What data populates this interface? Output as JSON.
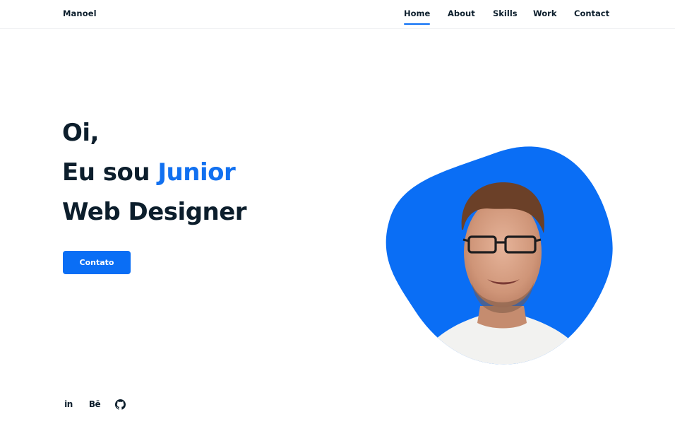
{
  "header": {
    "brand": "Manoel",
    "nav": [
      {
        "label": "Home",
        "active": true
      },
      {
        "label": "About",
        "active": false
      },
      {
        "label": "Skills",
        "active": false
      },
      {
        "label": "Work",
        "active": false
      },
      {
        "label": "Contact",
        "active": false
      }
    ]
  },
  "hero": {
    "greeting": "Oi,",
    "intro_prefix": "Eu sou ",
    "name": "Junior",
    "role": "Web Designer",
    "cta_label": "Contato"
  },
  "social": [
    {
      "icon": "linkedin-icon",
      "text": "in"
    },
    {
      "icon": "behance-icon",
      "text": "Bē"
    },
    {
      "icon": "github-icon",
      "text": ""
    }
  ],
  "colors": {
    "accent": "#0a6ef5",
    "text": "#0c1e2c",
    "background": "#ffffff"
  }
}
